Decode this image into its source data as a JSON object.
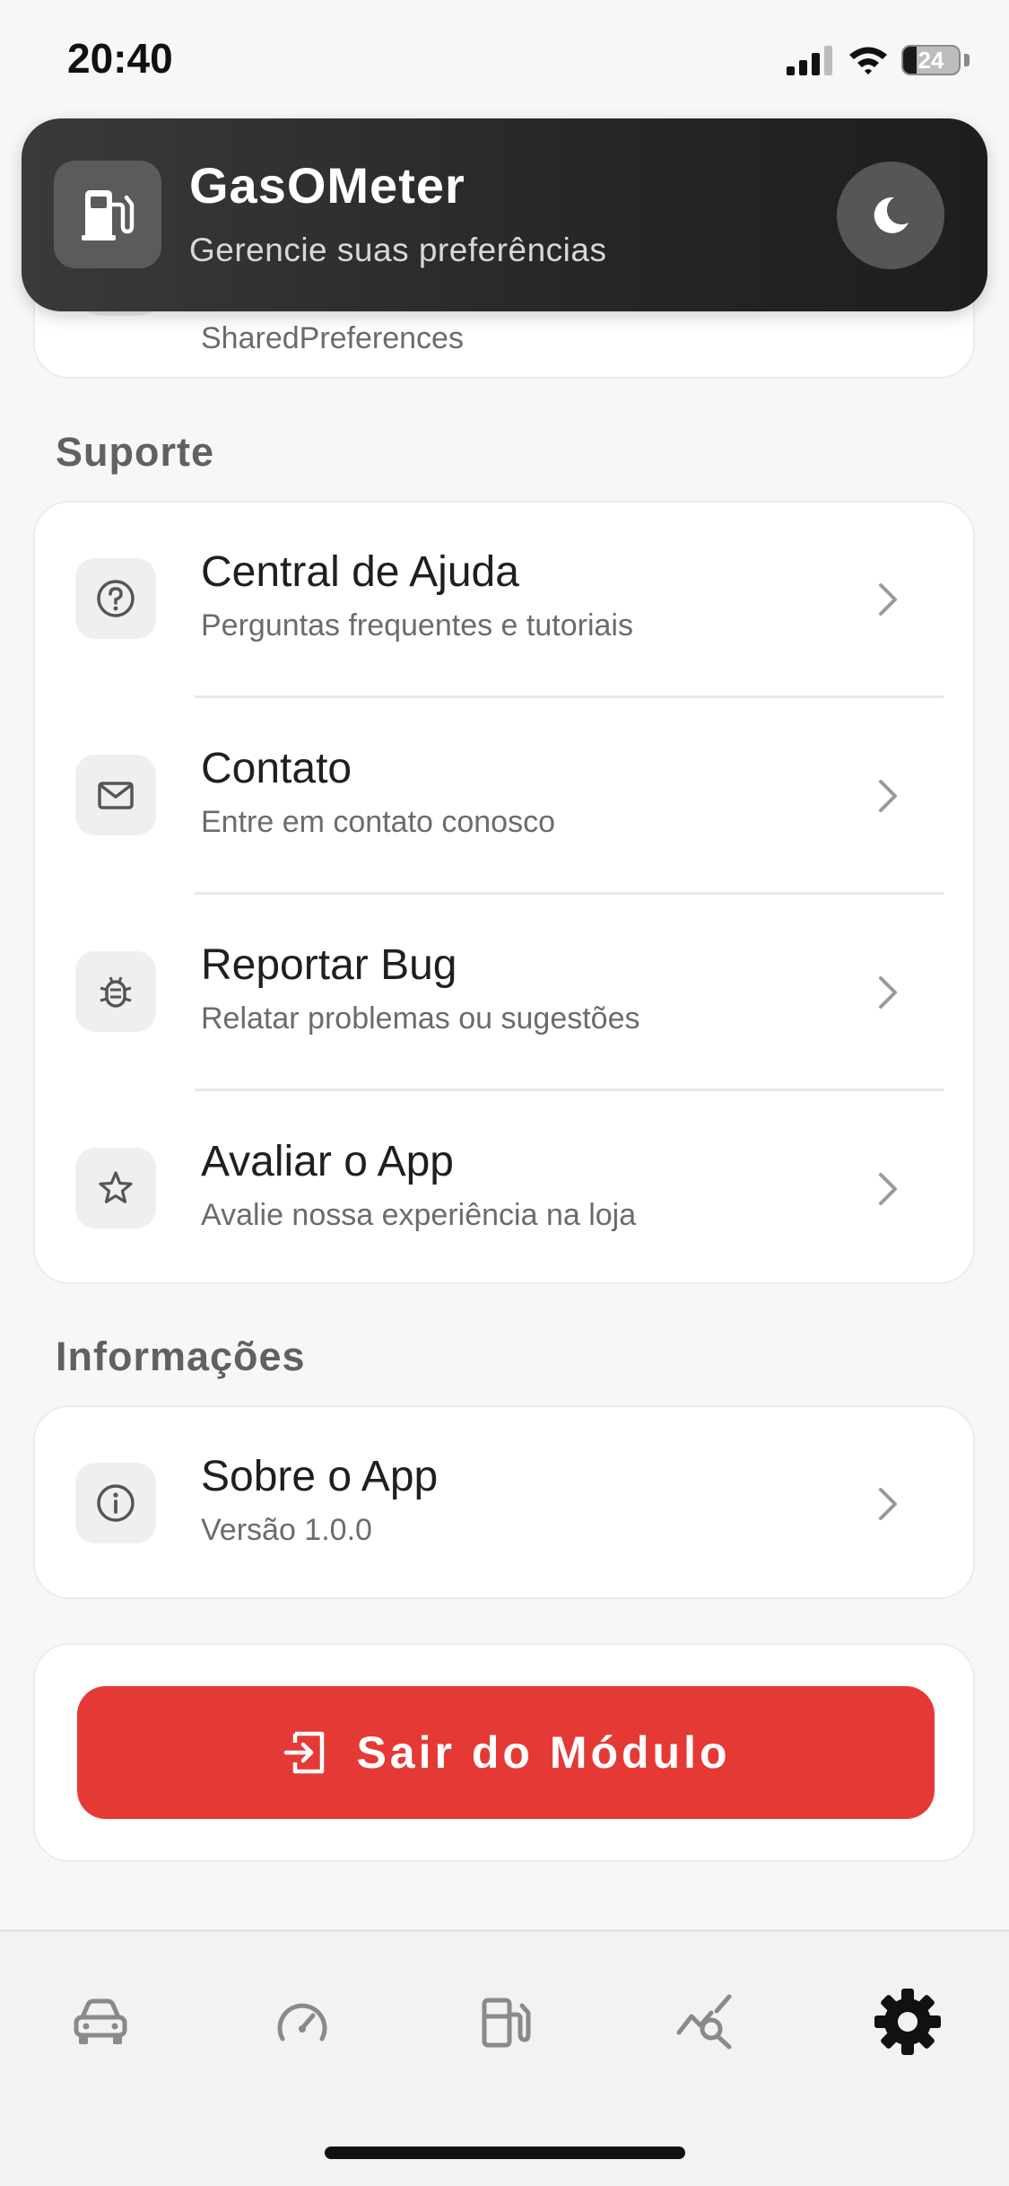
{
  "status_bar": {
    "time": "20:40",
    "battery_level": "24",
    "battery_fraction": 0.24
  },
  "header": {
    "title": "GasOMeter",
    "subtitle": "Gerencie suas preferências",
    "logo_icon": "fuel-pump-icon",
    "theme_toggle_icon": "moon-icon"
  },
  "partial_card": {
    "subtitle": "SharedPreferences"
  },
  "sections": {
    "support": {
      "title": "Suporte",
      "items": [
        {
          "title": "Central de Ajuda",
          "subtitle": "Perguntas frequentes e tutoriais",
          "icon": "help-circle-icon"
        },
        {
          "title": "Contato",
          "subtitle": "Entre em contato conosco",
          "icon": "mail-icon"
        },
        {
          "title": "Reportar Bug",
          "subtitle": "Relatar problemas ou sugestões",
          "icon": "bug-icon"
        },
        {
          "title": "Avaliar o App",
          "subtitle": "Avalie nossa experiência na loja",
          "icon": "star-icon"
        }
      ]
    },
    "info": {
      "title": "Informações",
      "items": [
        {
          "title": "Sobre o App",
          "subtitle": "Versão 1.0.0",
          "icon": "info-icon"
        }
      ]
    }
  },
  "logout": {
    "label": "Sair do Módulo",
    "icon": "logout-icon",
    "color": "#e53935"
  },
  "bottom_nav": {
    "items": [
      {
        "icon": "car-icon",
        "active": false
      },
      {
        "icon": "speedometer-icon",
        "active": false
      },
      {
        "icon": "gas-station-icon",
        "active": false
      },
      {
        "icon": "chart-search-icon",
        "active": false
      },
      {
        "icon": "settings-icon",
        "active": true
      }
    ],
    "active_color": "#111111",
    "inactive_color": "#8a8a8a"
  }
}
